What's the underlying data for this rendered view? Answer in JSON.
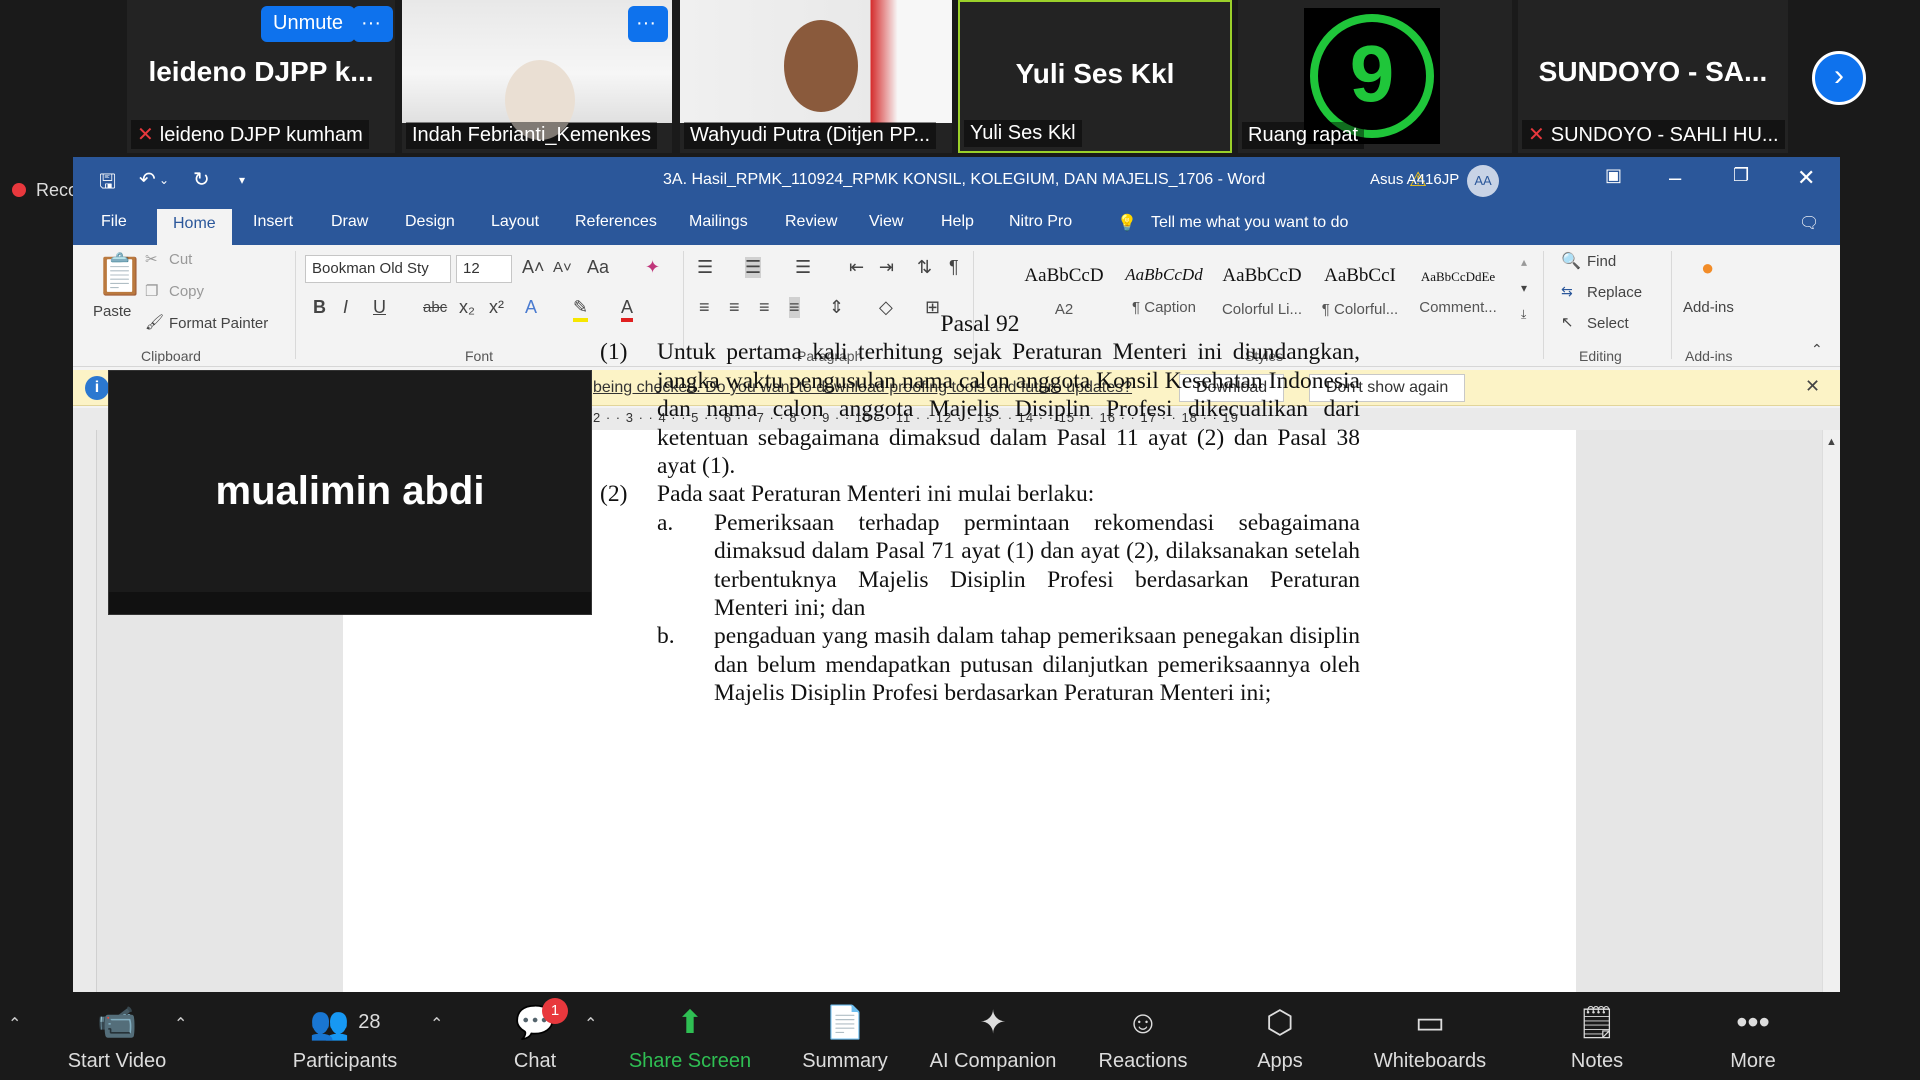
{
  "participants": [
    {
      "big_label": "leideno DJPP k...",
      "name": "leideno DJPP kumham",
      "muted": true
    },
    {
      "big_label": "",
      "name": "Indah Febrianti_Kemenkes",
      "muted": false
    },
    {
      "big_label": "",
      "name": "Wahyudi Putra (Ditjen PP...",
      "muted": false
    },
    {
      "big_label": "Yuli Ses Kkl",
      "name": "Yuli Ses Kkl",
      "muted": false
    },
    {
      "big_label": "9",
      "name": "Ruang rapat",
      "muted": false
    },
    {
      "big_label": "SUNDOYO - SA...",
      "name": "SUNDOYO - SAHLI HU...",
      "muted": true
    }
  ],
  "strip": {
    "unmute": "Unmute",
    "more": "···",
    "next": "›"
  },
  "recording": "Recording",
  "word": {
    "title": "3A. Hasil_RPMK_110924_RPMK KONSIL, KOLEGIUM, DAN MAJELIS_1706  -  Word",
    "account": "Asus A416JP",
    "avatar": "AA",
    "tabs": [
      "File",
      "Home",
      "Insert",
      "Draw",
      "Design",
      "Layout",
      "References",
      "Mailings",
      "Review",
      "View",
      "Help",
      "Nitro Pro"
    ],
    "tell_me": "Tell me what you want to do",
    "clipboard": {
      "paste": "Paste",
      "cut": "Cut",
      "copy": "Copy",
      "format_painter": "Format Painter",
      "label": "Clipboard"
    },
    "font": {
      "name": "Bookman Old Sty",
      "size": "12",
      "label": "Font"
    },
    "paragraph_label": "Paragraph",
    "styles": [
      {
        "preview": "AaBbCcD",
        "label": "A2"
      },
      {
        "preview": "AaBbCcDd",
        "label": "¶ Caption"
      },
      {
        "preview": "AaBbCcD",
        "label": "Colorful Li..."
      },
      {
        "preview": "AaBbCcI",
        "label": "¶ Colorful..."
      },
      {
        "preview": "AaBbCcDdEe",
        "label": "Comment..."
      }
    ],
    "styles_label": "Styles",
    "editing": {
      "find": "Find",
      "replace": "Replace",
      "select": "Select",
      "label": "Editing"
    },
    "addins": {
      "button": "Add-ins",
      "label": "Add-ins"
    },
    "infobar": {
      "message": "being checked. Do you want to download proofing tools and future updates?",
      "download": "Download",
      "dont_show": "Don't show again"
    },
    "ruler": "2 · · 3 · · 4 · · 5 · · 6 · · 7 · · 8 · · 9 · · 10 · · 11 · · 12 · · 13 · · 14 · · 15 · · 16 · · 17 · · 18 · · 19"
  },
  "document": {
    "heading": "Pasal 92",
    "item1_num": "(1)",
    "item1": "Untuk pertama kali terhitung sejak Peraturan Menteri ini diundangkan, jangka waktu pengusulan nama calon anggota Konsil Kesehatan Indonesia dan  nama calon anggota Majelis Disiplin Profesi dikecualikan dari ketentuan sebagaimana dimaksud dalam Pasal 11 ayat (2) dan Pasal 38 ayat (1).",
    "item2_num": "(2)",
    "item2": "Pada saat Peraturan Menteri ini mulai berlaku:",
    "sub_a_label": "a.",
    "sub_a": "Pemeriksaan terhadap permintaan rekomendasi sebagaimana dimaksud dalam Pasal 71 ayat (1) dan ayat (2), dilaksanakan setelah terbentuknya Majelis Disiplin Profesi berdasarkan Peraturan Menteri ini; dan",
    "sub_b_label": "b.",
    "sub_b": "pengaduan yang masih dalam tahap pemeriksaan penegakan disiplin dan belum mendapatkan putusan dilanjutkan pemeriksaannya oleh Majelis Disiplin Profesi berdasarkan Peraturan Menteri ini;"
  },
  "floating_video": {
    "name": "mualimin abdi"
  },
  "toolbar": {
    "start_video": "Start Video",
    "participants": "Participants",
    "participants_count": "28",
    "chat": "Chat",
    "chat_badge": "1",
    "share_screen": "Share Screen",
    "summary": "Summary",
    "ai_companion": "AI Companion",
    "reactions": "Reactions",
    "apps": "Apps",
    "whiteboards": "Whiteboards",
    "notes": "Notes",
    "more": "More"
  }
}
